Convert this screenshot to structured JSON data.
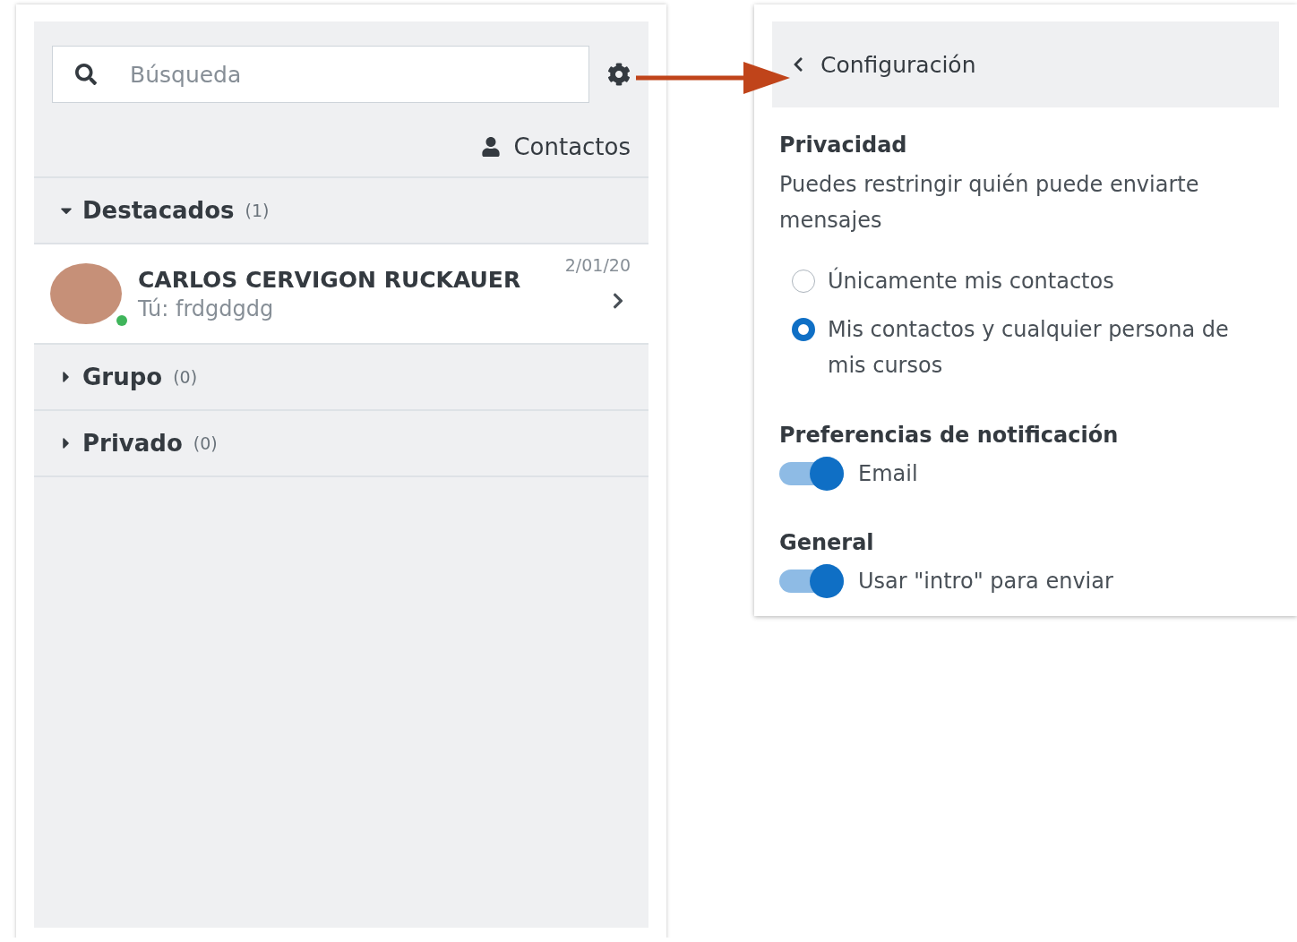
{
  "left_panel": {
    "search": {
      "placeholder": "Búsqueda"
    },
    "contacts_link": "Contactos",
    "sections": [
      {
        "title": "Destacados",
        "count": "(1)",
        "expanded": true,
        "conversations": [
          {
            "name": "CARLOS CERVIGON RUCKAUER",
            "date": "2/01/20",
            "last_message": "Tú: frdgdgdg",
            "online": true
          }
        ]
      },
      {
        "title": "Grupo",
        "count": "(0)",
        "expanded": false
      },
      {
        "title": "Privado",
        "count": "(0)",
        "expanded": false
      }
    ]
  },
  "settings_panel": {
    "title": "Configuración",
    "sections": [
      {
        "kind": "radio",
        "heading": "Privacidad",
        "description": "Puedes restringir quién puede enviarte mensajes",
        "options": [
          {
            "label": "Únicamente mis contactos",
            "selected": false
          },
          {
            "label": "Mis contactos y cualquier persona de mis cursos",
            "selected": true
          }
        ]
      },
      {
        "kind": "toggle",
        "heading": "Preferencias de notificación",
        "toggles": [
          {
            "label": "Email",
            "on": true
          }
        ]
      },
      {
        "kind": "toggle",
        "heading": "General",
        "toggles": [
          {
            "label": "Usar \"intro\" para enviar",
            "on": true
          }
        ]
      }
    ]
  }
}
